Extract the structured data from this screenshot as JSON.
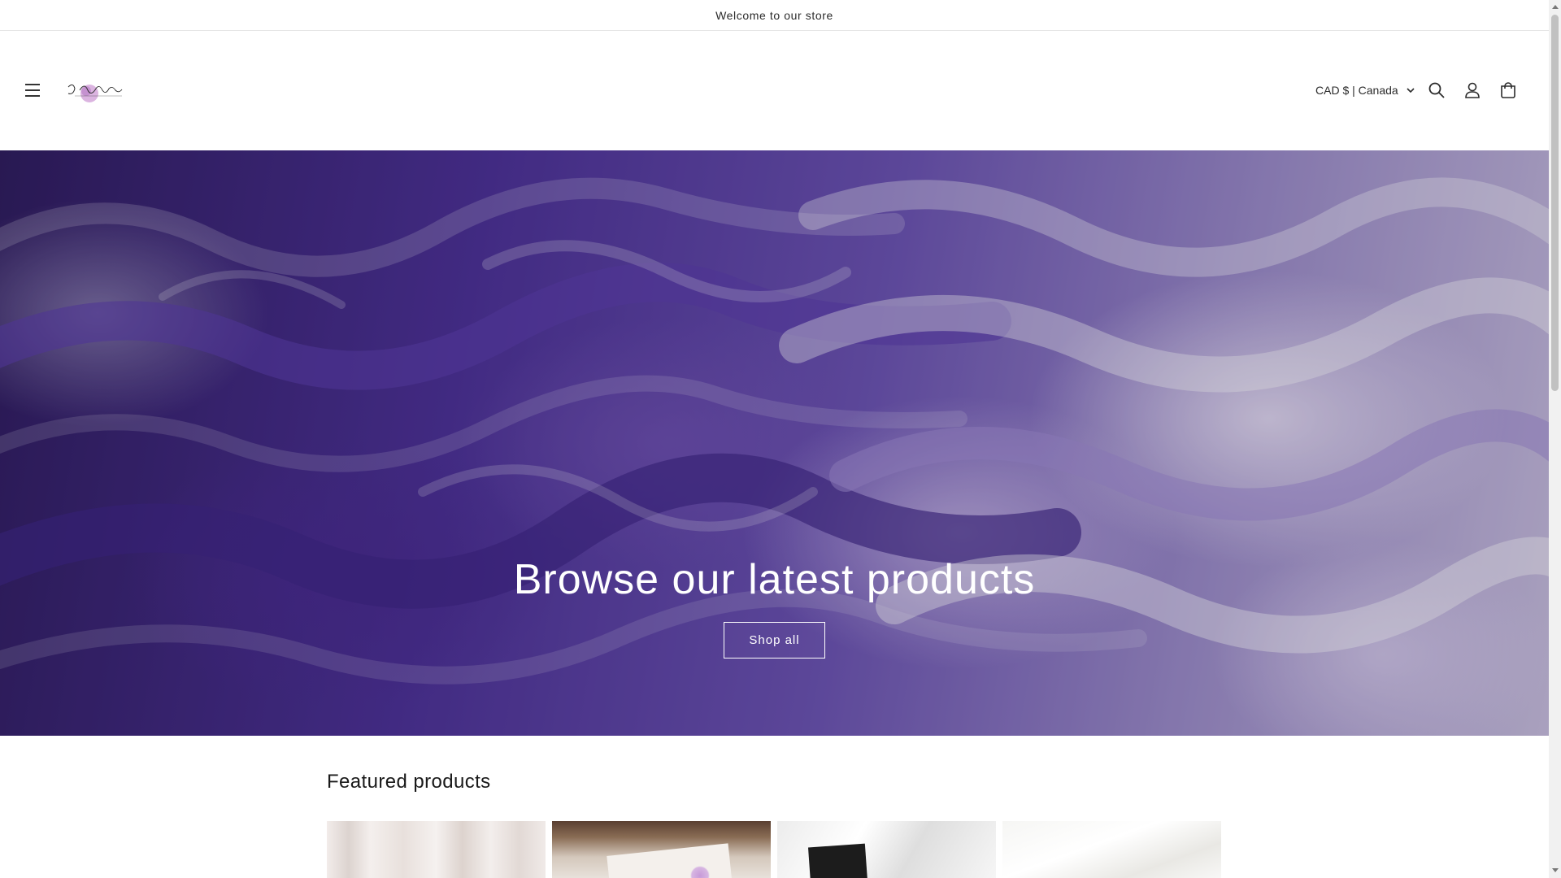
{
  "announcement": {
    "text": "Welcome to our store"
  },
  "header": {
    "logo_text": "D'Ascenza",
    "country_selector": {
      "label": "CAD $ | Canada"
    },
    "icons": {
      "menu": "hamburger-icon",
      "search": "search-icon",
      "account": "account-icon",
      "cart": "cart-icon"
    }
  },
  "hero": {
    "title": "Browse our latest products",
    "button_label": "Shop all",
    "image": "purple-paint-swirls"
  },
  "featured": {
    "title": "Featured products",
    "products": [
      {
        "image": "white-fabric-draped"
      },
      {
        "image": "card-with-logo-on-table"
      },
      {
        "image": "black-box-on-white-satin"
      },
      {
        "image": "white-satin-fabric"
      }
    ]
  },
  "colors": {
    "hero_tint": "#5b3fa3",
    "text": "#121212",
    "button_border": "#ffffff"
  }
}
